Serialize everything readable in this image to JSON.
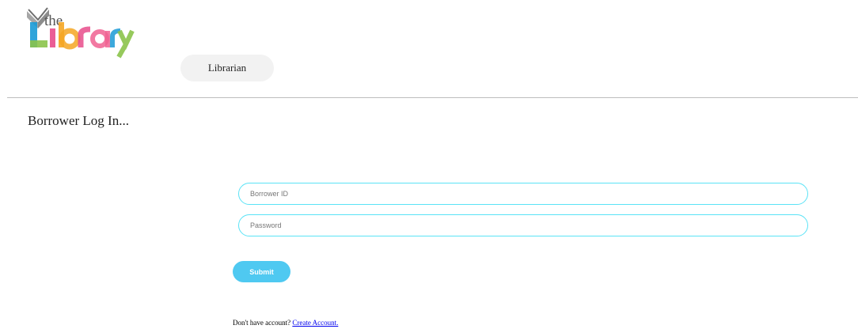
{
  "header": {
    "logo": {
      "small_text": "the",
      "big_text": "Library",
      "icon": "open-book-icon",
      "colors": [
        "#1a9ad6",
        "#e84c8b",
        "#f5a623",
        "#8bc34a",
        "#9e9e9e"
      ]
    },
    "nav": {
      "librarian_label": "Librarian"
    }
  },
  "main": {
    "title": "Borrower Log In...",
    "form": {
      "borrower_id": {
        "placeholder": "Borrower ID",
        "value": ""
      },
      "password": {
        "placeholder": "Password",
        "value": ""
      },
      "submit_label": "Submit"
    },
    "signup": {
      "prompt": "Don't have account?",
      "link_label": "Create Account."
    }
  },
  "theme": {
    "field_border": "#5ae3f6",
    "submit_bg": "#4fc9f1",
    "nav_bg": "#f2f2f2",
    "link": "#0000ee"
  }
}
